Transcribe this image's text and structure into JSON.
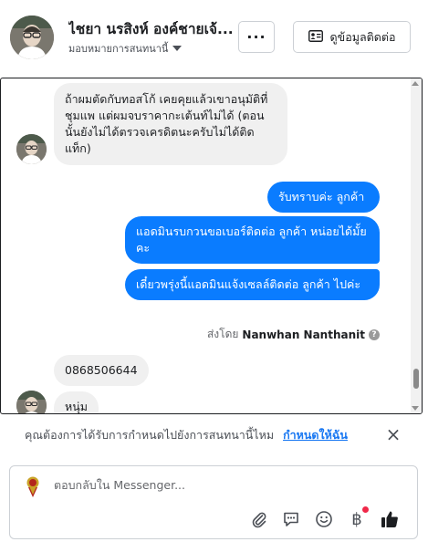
{
  "header": {
    "name": "ไชยา นรสิงห์ องค์ชายเจ้...",
    "assignee_label": "มอบหมายการสนทนานี้",
    "more_label": "···",
    "contact_label": "ดูข้อมูลติดต่อ"
  },
  "messages": [
    {
      "side": "in",
      "text": "ถ้าผมตัดกับทอสโก้ เคยคุยแล้วเขาอนุมัติที่ชุมแพ แต่ผมจบราคากะเต้นท์ไม่ได้ (ตอนนั้นยังไม่ได้ตรวจเครดิตนะครับไม่ได้ติดแท็ก)"
    },
    {
      "side": "out",
      "text": "รับทราบค่ะ ลูกค้า"
    },
    {
      "side": "out",
      "text": "แอดมินรบกวนขอเบอร์ติดต่อ ลูกค้า หน่อยได้มั้ยคะ"
    },
    {
      "side": "out",
      "text": "เดี๋ยวพรุ่งนี้แอดมินแจ้งเซลล์ติดต่อ ลูกค้า ไปค่ะ"
    },
    {
      "side": "in",
      "text": "0868506644"
    },
    {
      "side": "in",
      "text": "หนุ่ม"
    }
  ],
  "sent_by": {
    "prefix": "ส่งโดย",
    "name": "Nanwhan Nanthanit",
    "info_icon": "?"
  },
  "notice": {
    "text": "คุณต้องการได้รับการกำหนดไปยังการสนทนานี้ไหม",
    "link": "กำหนดให้ฉัน",
    "close": "×"
  },
  "composer": {
    "placeholder": "ตอบกลับใน Messenger...",
    "icons": [
      "paperclip-icon",
      "chat-bubble-icon",
      "smiley-icon",
      "baht-icon",
      "thumbs-up-icon"
    ],
    "baht_glyph": "฿"
  },
  "colors": {
    "outgoing_bubble": "#0a7cff",
    "incoming_bubble": "#f0f0f0",
    "link": "#1877f2",
    "notification_dot": "#f02849"
  }
}
